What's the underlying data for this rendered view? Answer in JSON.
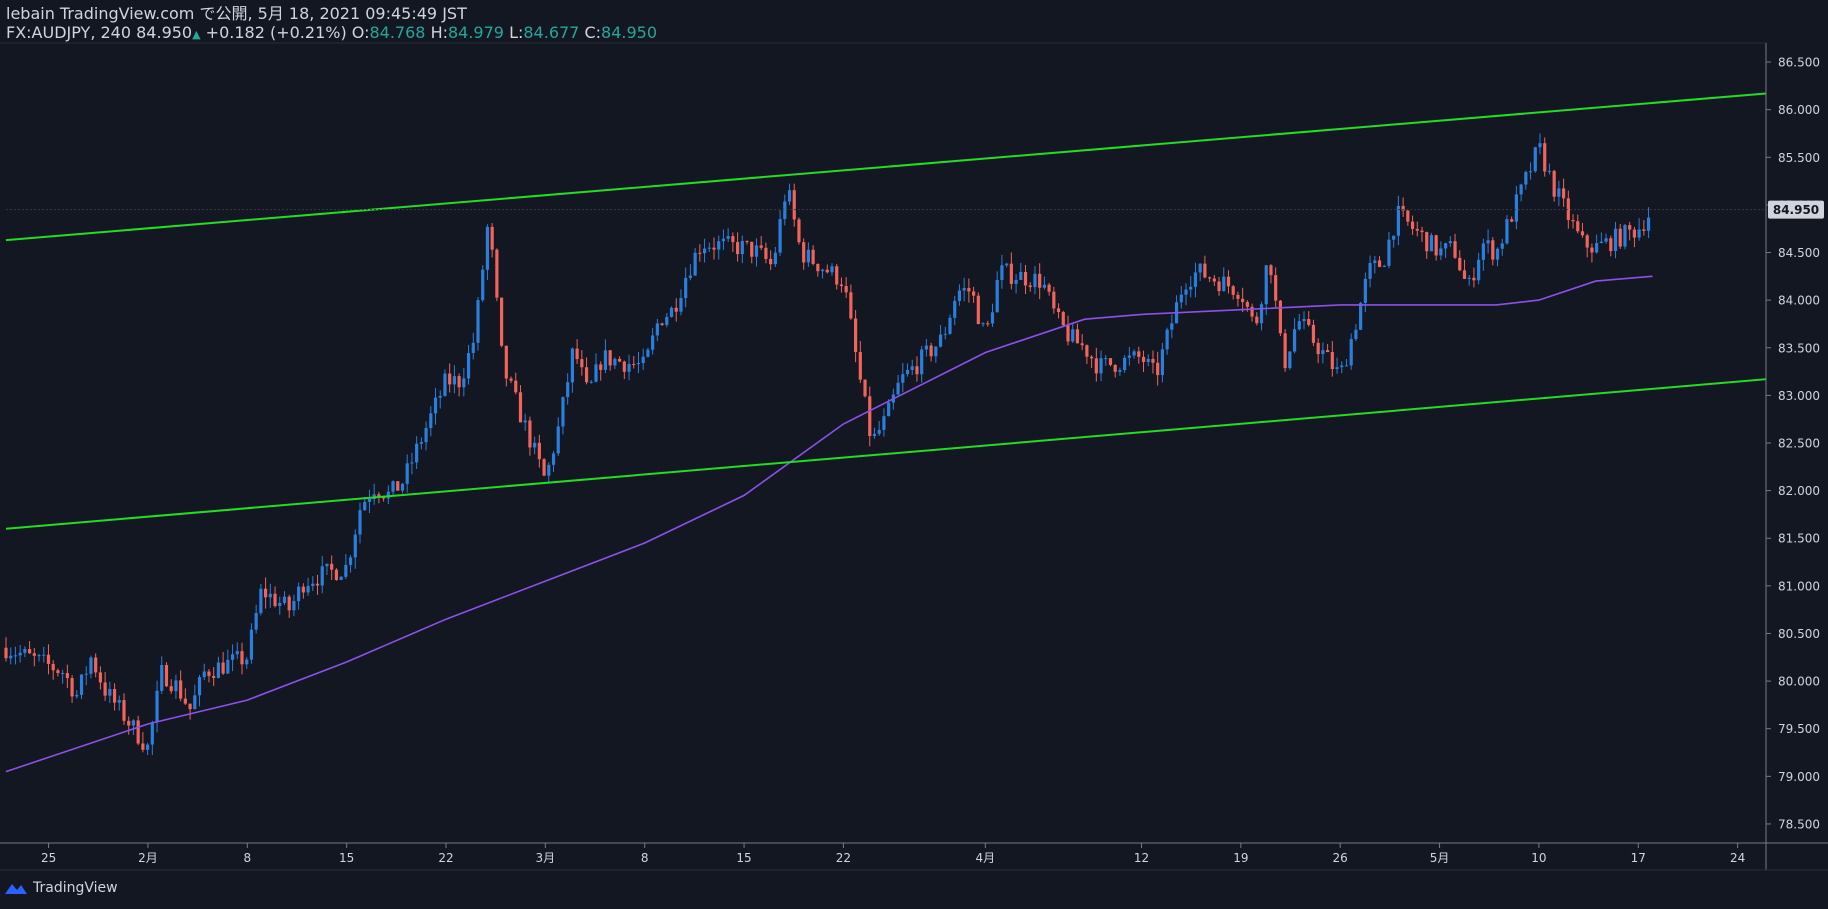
{
  "header": {
    "publish_line": "lebain TradingView.com で公開, 5月 18, 2021 09:45:49 JST",
    "symbol": "FX:AUDJPY, 240",
    "last": "84.950",
    "change_arrow": "▲",
    "change": "+0.182 (+0.21%)",
    "o_label": "O:",
    "o_val": "84.768",
    "h_label": "H:",
    "h_val": "84.979",
    "l_label": "L:",
    "l_val": "84.677",
    "c_label": "C:",
    "c_val": "84.950"
  },
  "footer": {
    "brand": "TradingView"
  },
  "colors": {
    "background": "#131722",
    "up_candle": "#2a7fdc",
    "down_candle": "#f0645a",
    "channel_lines": "#22dd22",
    "moving_average": "#8c52e8",
    "price_label_bg": "#d1d4dc"
  },
  "chart_data": {
    "type": "candlestick",
    "symbol": "FX:AUDJPY",
    "timeframe": "240",
    "last_price": 84.95,
    "ylim": [
      78.3,
      86.7
    ],
    "y_ticks": [
      78.5,
      79.0,
      79.5,
      80.0,
      80.5,
      81.0,
      81.5,
      82.0,
      82.5,
      83.0,
      83.5,
      84.0,
      84.5,
      85.0,
      85.5,
      86.0,
      86.5
    ],
    "y_tick_labels": [
      "78.500",
      "79.000",
      "79.500",
      "80.000",
      "80.500",
      "81.000",
      "81.500",
      "82.000",
      "82.500",
      "83.000",
      "83.500",
      "84.000",
      "84.500",
      "85.000",
      "85.500",
      "86.000",
      "86.500"
    ],
    "x_ticks": [
      {
        "label": "25",
        "date": "2021-01-25"
      },
      {
        "label": "2月",
        "date": "2021-02-01"
      },
      {
        "label": "8",
        "date": "2021-02-08"
      },
      {
        "label": "15",
        "date": "2021-02-15"
      },
      {
        "label": "22",
        "date": "2021-02-22"
      },
      {
        "label": "3月",
        "date": "2021-03-01"
      },
      {
        "label": "8",
        "date": "2021-03-08"
      },
      {
        "label": "15",
        "date": "2021-03-15"
      },
      {
        "label": "22",
        "date": "2021-03-22"
      },
      {
        "label": "4月",
        "date": "2021-04-01"
      },
      {
        "label": "12",
        "date": "2021-04-12"
      },
      {
        "label": "19",
        "date": "2021-04-19"
      },
      {
        "label": "26",
        "date": "2021-04-26"
      },
      {
        "label": "5月",
        "date": "2021-05-03"
      },
      {
        "label": "10",
        "date": "2021-05-10"
      },
      {
        "label": "17",
        "date": "2021-05-17"
      },
      {
        "label": "24",
        "date": "2021-05-24"
      }
    ],
    "close_path": [
      [
        "2021-01-22",
        80.35
      ],
      [
        "2021-01-26",
        80.1
      ],
      [
        "2021-01-27",
        79.85
      ],
      [
        "2021-01-28",
        80.25
      ],
      [
        "2021-01-29",
        79.9
      ],
      [
        "2021-02-01",
        79.3
      ],
      [
        "2021-02-02",
        80.1
      ],
      [
        "2021-02-03",
        79.95
      ],
      [
        "2021-02-04",
        79.7
      ],
      [
        "2021-02-05",
        80.1
      ],
      [
        "2021-02-08",
        80.25
      ],
      [
        "2021-02-09",
        80.95
      ],
      [
        "2021-02-10",
        80.85
      ],
      [
        "2021-02-11",
        80.75
      ],
      [
        "2021-02-12",
        81.05
      ],
      [
        "2021-02-15",
        81.2
      ],
      [
        "2021-02-16",
        81.85
      ],
      [
        "2021-02-17",
        82.05
      ],
      [
        "2021-02-18",
        81.95
      ],
      [
        "2021-02-19",
        82.1
      ],
      [
        "2021-02-22",
        83.15
      ],
      [
        "2021-02-23",
        83.15
      ],
      [
        "2021-02-24",
        83.6
      ],
      [
        "2021-02-25",
        84.85
      ],
      [
        "2021-02-26",
        83.3
      ],
      [
        "2021-03-01",
        82.1
      ],
      [
        "2021-03-02",
        82.7
      ],
      [
        "2021-03-03",
        83.5
      ],
      [
        "2021-03-04",
        83.0
      ],
      [
        "2021-03-05",
        83.4
      ],
      [
        "2021-03-08",
        83.3
      ],
      [
        "2021-03-09",
        83.8
      ],
      [
        "2021-03-10",
        83.9
      ],
      [
        "2021-03-11",
        84.3
      ],
      [
        "2021-03-12",
        84.6
      ],
      [
        "2021-03-15",
        84.55
      ],
      [
        "2021-03-16",
        84.5
      ],
      [
        "2021-03-17",
        84.35
      ],
      [
        "2021-03-18",
        85.2
      ],
      [
        "2021-03-19",
        84.5
      ],
      [
        "2021-03-22",
        84.2
      ],
      [
        "2021-03-23",
        83.3
      ],
      [
        "2021-03-24",
        82.5
      ],
      [
        "2021-03-25",
        82.75
      ],
      [
        "2021-03-26",
        83.15
      ],
      [
        "2021-03-29",
        83.6
      ],
      [
        "2021-03-30",
        84.1
      ],
      [
        "2021-03-31",
        84.1
      ],
      [
        "2021-04-01",
        83.6
      ],
      [
        "2021-04-02",
        84.3
      ],
      [
        "2021-04-05",
        84.2
      ],
      [
        "2021-04-06",
        83.8
      ],
      [
        "2021-04-07",
        83.6
      ],
      [
        "2021-04-08",
        83.5
      ],
      [
        "2021-04-09",
        83.3
      ],
      [
        "2021-04-12",
        83.4
      ],
      [
        "2021-04-13",
        83.2
      ],
      [
        "2021-04-14",
        83.7
      ],
      [
        "2021-04-15",
        84.2
      ],
      [
        "2021-04-16",
        84.3
      ],
      [
        "2021-04-19",
        84.1
      ],
      [
        "2021-04-20",
        83.7
      ],
      [
        "2021-04-21",
        84.5
      ],
      [
        "2021-04-22",
        83.3
      ],
      [
        "2021-04-23",
        83.8
      ],
      [
        "2021-04-26",
        83.2
      ],
      [
        "2021-04-27",
        83.7
      ],
      [
        "2021-04-28",
        84.3
      ],
      [
        "2021-04-29",
        84.4
      ],
      [
        "2021-04-30",
        84.9
      ],
      [
        "2021-05-03",
        84.5
      ],
      [
        "2021-05-04",
        84.55
      ],
      [
        "2021-05-05",
        84.1
      ],
      [
        "2021-05-06",
        84.6
      ],
      [
        "2021-05-07",
        84.5
      ],
      [
        "2021-05-10",
        85.6
      ],
      [
        "2021-05-11",
        85.2
      ],
      [
        "2021-05-12",
        84.9
      ],
      [
        "2021-05-13",
        84.6
      ],
      [
        "2021-05-14",
        84.55
      ],
      [
        "2021-05-17",
        84.75
      ],
      [
        "2021-05-18",
        84.95
      ]
    ],
    "moving_average_points": [
      [
        "2021-01-22",
        79.05
      ],
      [
        "2021-02-01",
        79.55
      ],
      [
        "2021-02-08",
        79.8
      ],
      [
        "2021-02-15",
        80.2
      ],
      [
        "2021-02-22",
        80.65
      ],
      [
        "2021-03-01",
        81.05
      ],
      [
        "2021-03-08",
        81.45
      ],
      [
        "2021-03-15",
        81.95
      ],
      [
        "2021-03-22",
        82.7
      ],
      [
        "2021-04-01",
        83.45
      ],
      [
        "2021-04-08",
        83.8
      ],
      [
        "2021-04-12",
        83.85
      ],
      [
        "2021-04-19",
        83.9
      ],
      [
        "2021-04-26",
        83.95
      ],
      [
        "2021-05-03",
        83.95
      ],
      [
        "2021-05-07",
        83.95
      ],
      [
        "2021-05-10",
        84.0
      ],
      [
        "2021-05-14",
        84.2
      ],
      [
        "2021-05-18",
        84.25
      ]
    ],
    "upper_channel": [
      [
        "2021-01-22",
        84.63
      ],
      [
        "2021-05-26",
        86.17
      ]
    ],
    "lower_channel": [
      [
        "2021-01-22",
        81.6
      ],
      [
        "2021-05-26",
        83.17
      ]
    ]
  }
}
